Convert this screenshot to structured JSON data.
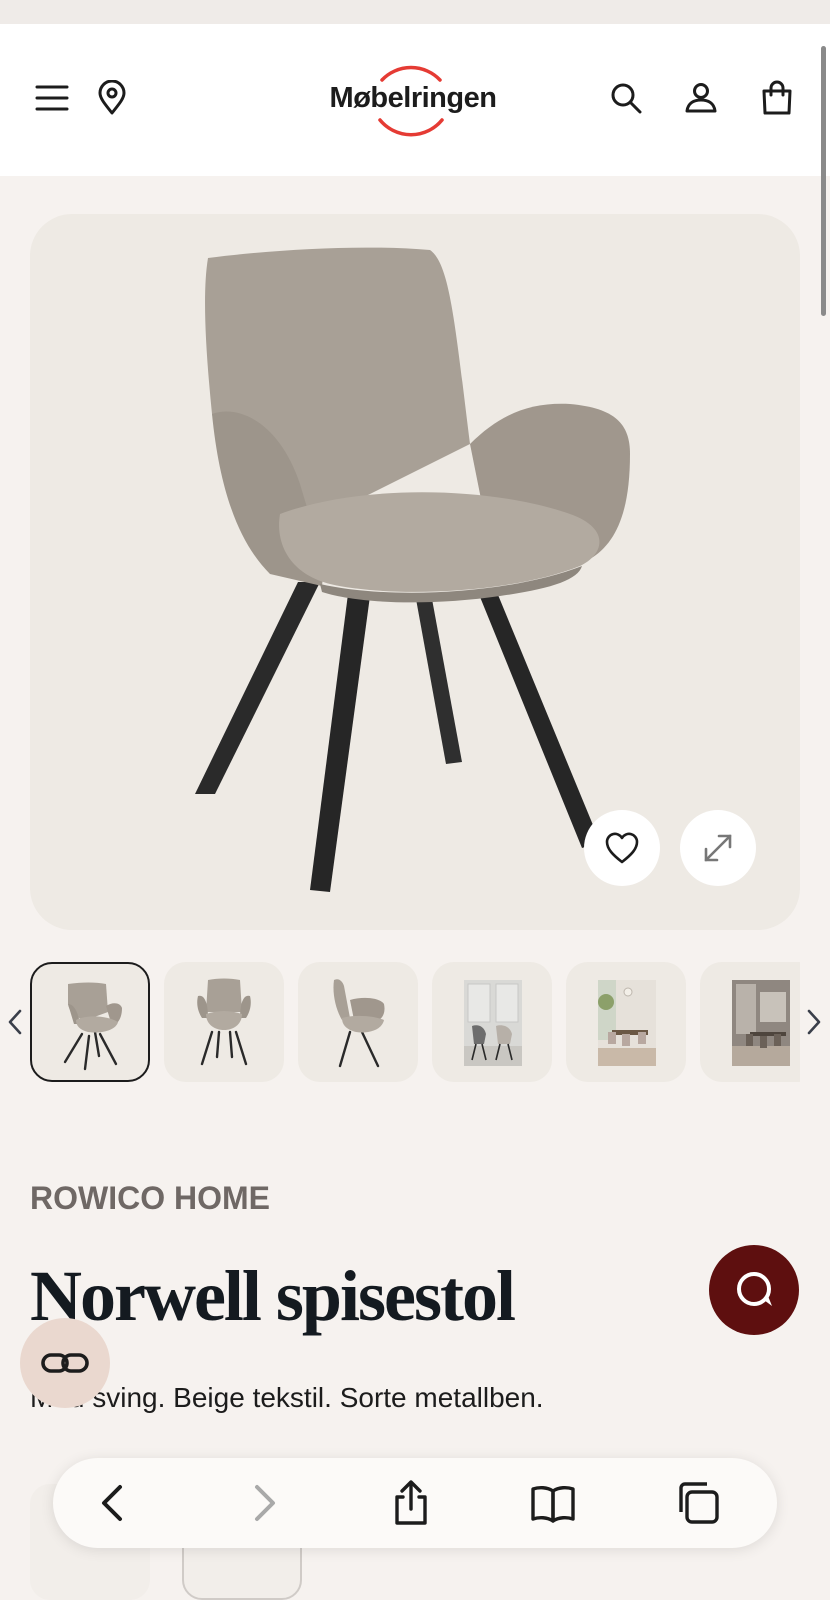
{
  "header": {
    "logo_text": "Møbelringen",
    "icons": [
      "menu-icon",
      "location-pin-icon",
      "search-icon",
      "user-icon",
      "shopping-bag-icon"
    ]
  },
  "product": {
    "brand": "ROWICO HOME",
    "title": "Norwell spisestol",
    "subtitle": "Med sving. Beige tekstil. Sorte metallben."
  },
  "gallery": {
    "active_index": 0,
    "thumbnail_count": 6
  },
  "colors": {
    "brand_red": "#e53b34",
    "chat_button": "#5e0f0f",
    "compare_button": "#ead8cf",
    "fabric": "#a79e95",
    "background": "#f6f2ef"
  },
  "browser_toolbar": {
    "icons": [
      "back-icon",
      "forward-icon",
      "share-icon",
      "bookmarks-icon",
      "tabs-icon"
    ]
  }
}
